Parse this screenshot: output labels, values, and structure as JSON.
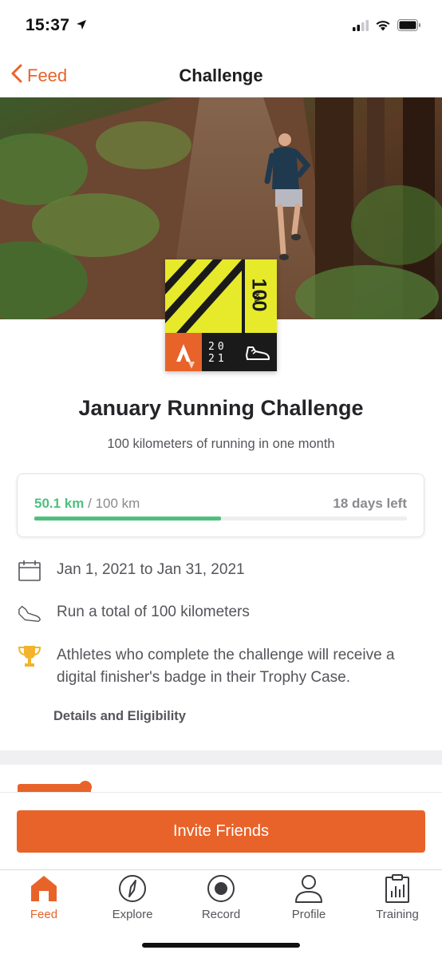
{
  "status_bar": {
    "time": "15:37"
  },
  "nav": {
    "back_label": "Feed",
    "title": "Challenge"
  },
  "badge": {
    "distance": "100",
    "unit": "KM",
    "year_top": "20",
    "year_bottom": "21"
  },
  "challenge": {
    "title": "January Running Challenge",
    "subtitle": "100 kilometers of running in one month"
  },
  "progress": {
    "current": "50.1 km",
    "separator": " / ",
    "goal": "100 km",
    "days_left": "18 days left",
    "fraction": 0.501,
    "color": "#4fbf7e"
  },
  "details": [
    {
      "icon": "calendar-icon",
      "text": "Jan 1, 2021 to Jan 31, 2021"
    },
    {
      "icon": "shoe-icon",
      "text": "Run a total of 100 kilometers"
    },
    {
      "icon": "trophy-icon",
      "text": "Athletes who complete the challenge will receive a digital finisher's badge in their Trophy Case."
    }
  ],
  "details_link": "Details and Eligibility",
  "invite_button": "Invite Friends",
  "tabs": [
    {
      "label": "Feed",
      "icon": "home-icon",
      "active": true
    },
    {
      "label": "Explore",
      "icon": "compass-icon",
      "active": false
    },
    {
      "label": "Record",
      "icon": "record-icon",
      "active": false
    },
    {
      "label": "Profile",
      "icon": "profile-icon",
      "active": false
    },
    {
      "label": "Training",
      "icon": "training-icon",
      "active": false
    }
  ],
  "colors": {
    "accent": "#e8632a",
    "badge_yellow": "#e6ea2b",
    "progress_green": "#4fbf7e"
  }
}
